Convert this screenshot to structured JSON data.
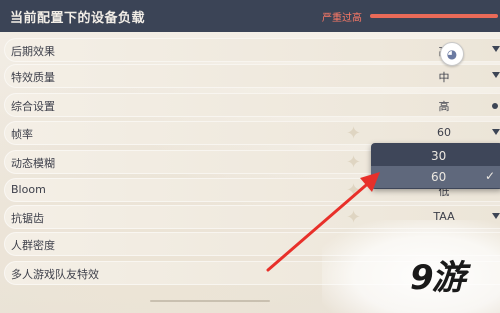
{
  "header": {
    "title": "当前配置下的设备负载",
    "load_label": "严重过高"
  },
  "settings": [
    {
      "label": "后期效果",
      "value": "高"
    },
    {
      "label": "特效质量",
      "value": "中"
    },
    {
      "label": "综合设置",
      "value": "高"
    },
    {
      "label": "帧率",
      "value": "60"
    },
    {
      "label": "动态模糊",
      "value": ""
    },
    {
      "label": "Bloom",
      "value": "低"
    },
    {
      "label": "抗锯齿",
      "value": "TAA"
    },
    {
      "label": "人群密度",
      "value": ""
    },
    {
      "label": "多人游戏队友特效",
      "value": ""
    }
  ],
  "dropdown": {
    "options": [
      "30",
      "60"
    ],
    "selected": "60"
  },
  "watermark": {
    "text": "9游"
  },
  "colors": {
    "header_bg": "#3b4456",
    "warning": "#e96a58",
    "arrow": "#e8302a",
    "dropdown_bg": "#3e4659"
  }
}
